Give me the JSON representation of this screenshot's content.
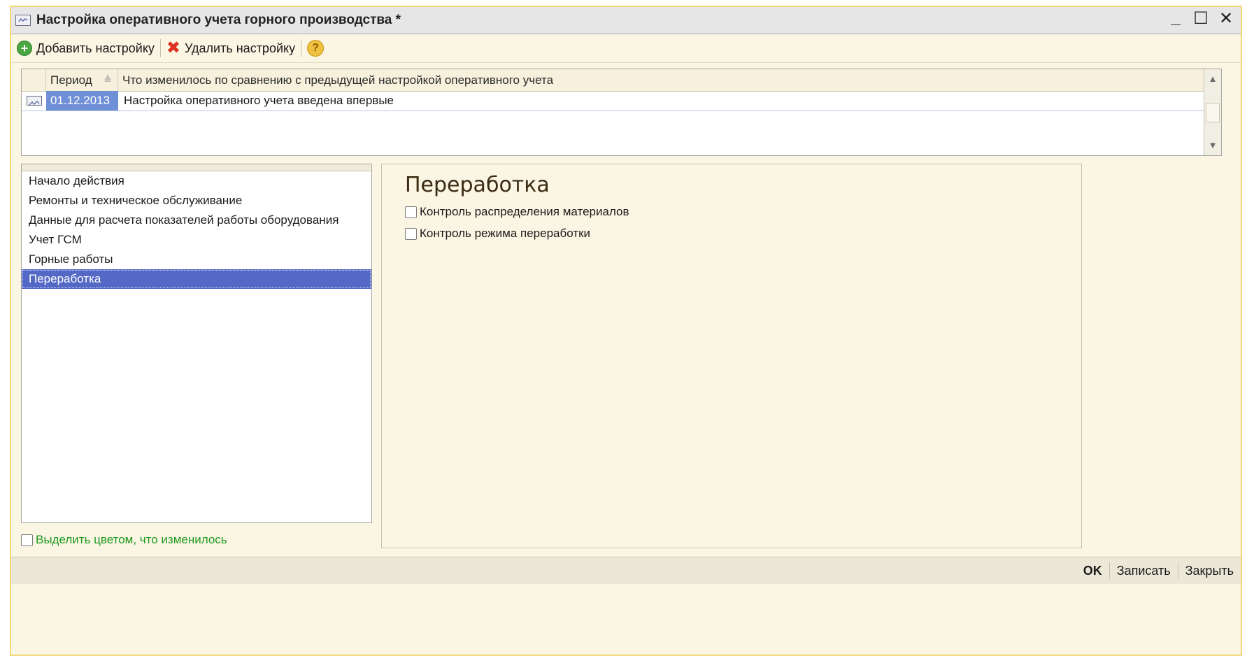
{
  "window": {
    "title": "Настройка оперативного учета горного производства *",
    "controls": {
      "minimize": "_",
      "maximize": "☐",
      "close": "✕"
    }
  },
  "toolbar": {
    "add_label": "Добавить настройку",
    "delete_label": "Удалить настройку",
    "help_label": "?"
  },
  "grid": {
    "columns": {
      "period": "Период",
      "description": "Что изменилось по сравнению с предыдущей настройкой оперативного учета"
    },
    "rows": [
      {
        "period": "01.12.2013",
        "description": "Настройка оперативного учета введена впервые"
      }
    ]
  },
  "nav": {
    "items": [
      {
        "label": "Начало действия"
      },
      {
        "label": "Ремонты и техническое обслуживание"
      },
      {
        "label": "Данные для расчета показателей работы оборудования"
      },
      {
        "label": "Учет ГСМ"
      },
      {
        "label": "Горные работы"
      },
      {
        "label": "Переработка",
        "selected": true
      }
    ]
  },
  "panel": {
    "title": "Переработка",
    "checkboxes": [
      {
        "label": "Контроль распределения материалов",
        "checked": false
      },
      {
        "label": "Контроль режима переработки",
        "checked": false
      }
    ]
  },
  "highlight_changes": {
    "label": "Выделить цветом, что изменилось",
    "checked": false
  },
  "footer": {
    "ok_label": "OK",
    "save_label": "Записать",
    "close_label": "Закрыть"
  },
  "colors": {
    "selection": "#5468c6",
    "period_cell": "#6f8fd6",
    "window_bg": "#fbf5e3",
    "green_text": "#1e9b1e"
  }
}
